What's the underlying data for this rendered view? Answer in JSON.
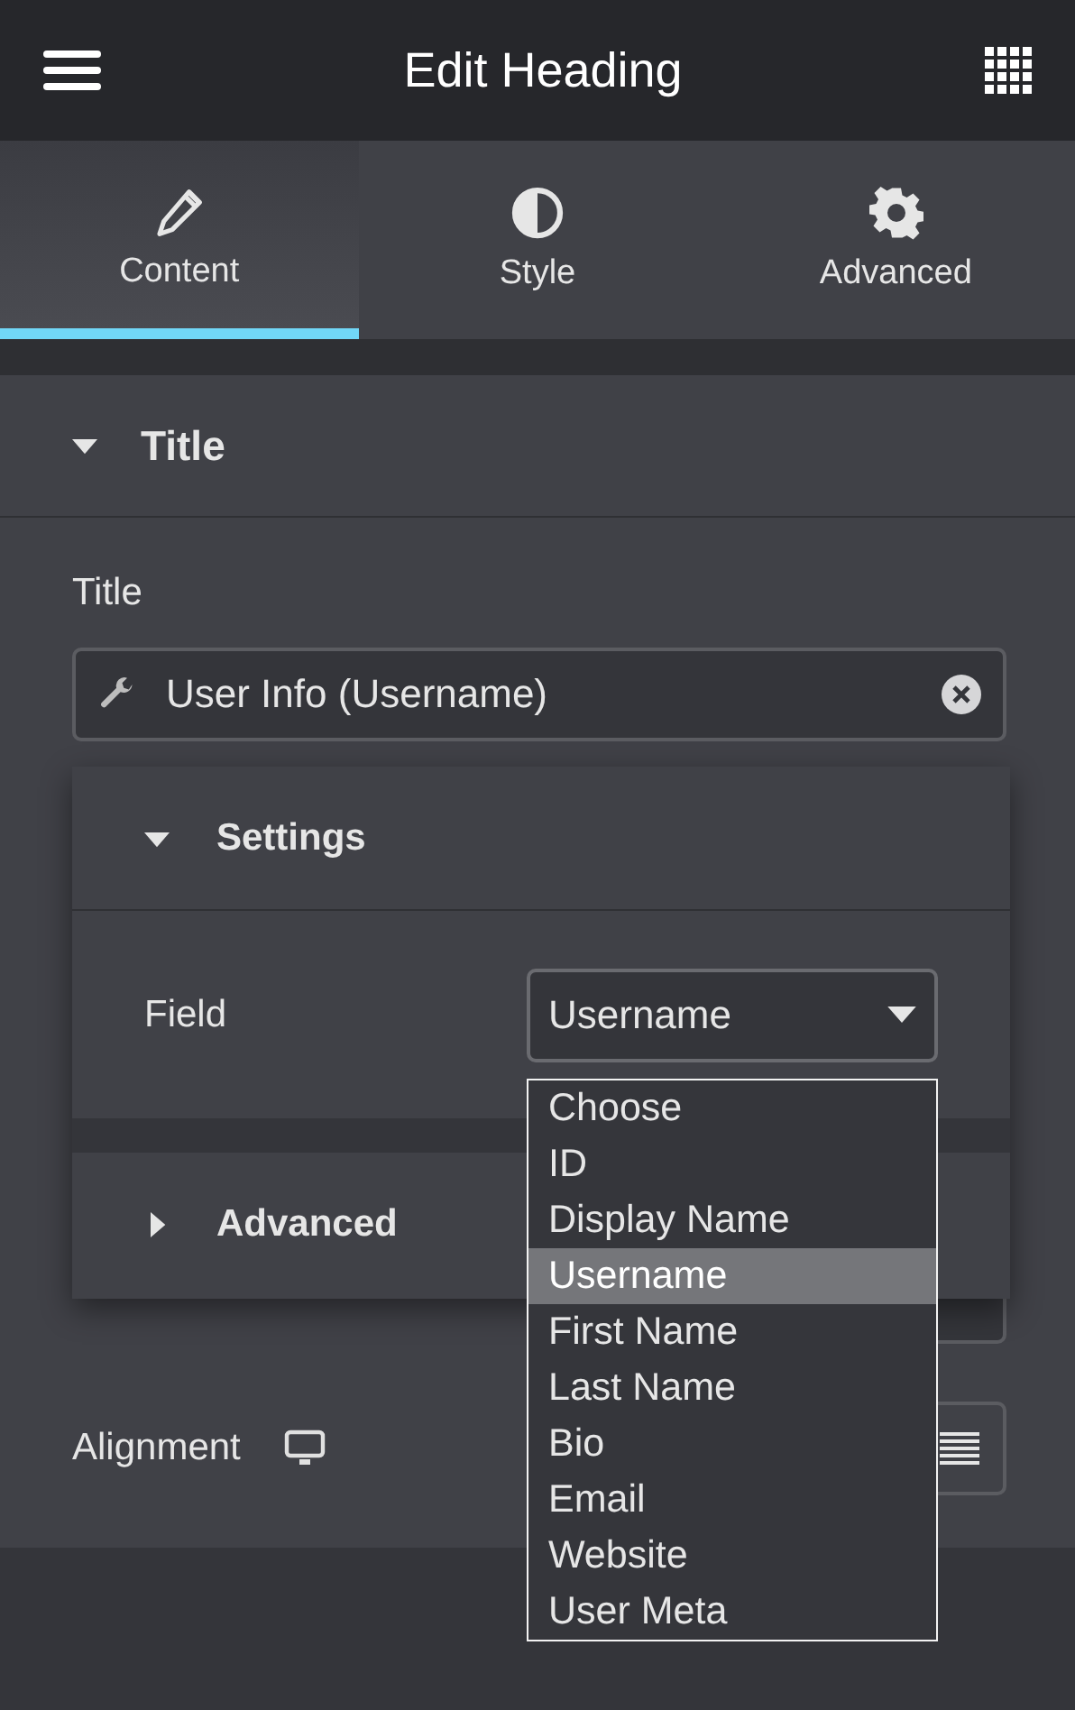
{
  "header": {
    "title": "Edit Heading"
  },
  "tabs": [
    {
      "label": "Content",
      "kind": "pencil",
      "selected": true
    },
    {
      "label": "Style",
      "kind": "contrast",
      "selected": false
    },
    {
      "label": "Advanced",
      "kind": "gear",
      "selected": false
    }
  ],
  "section": {
    "title": "Title",
    "expanded": true
  },
  "title_field": {
    "label": "Title",
    "value": "User Info (Username)"
  },
  "alignment": {
    "label": "Alignment"
  },
  "popup": {
    "sections": [
      {
        "title": "Settings",
        "expanded": true
      },
      {
        "title": "Advanced",
        "expanded": false
      }
    ],
    "field": {
      "label": "Field",
      "value": "Username"
    },
    "options": [
      {
        "label": "Choose",
        "selected": false
      },
      {
        "label": "ID",
        "selected": false
      },
      {
        "label": "Display Name",
        "selected": false
      },
      {
        "label": "Username",
        "selected": true
      },
      {
        "label": "First Name",
        "selected": false
      },
      {
        "label": "Last Name",
        "selected": false
      },
      {
        "label": "Bio",
        "selected": false
      },
      {
        "label": "Email",
        "selected": false
      },
      {
        "label": "Website",
        "selected": false
      },
      {
        "label": "User Meta",
        "selected": false
      }
    ]
  }
}
